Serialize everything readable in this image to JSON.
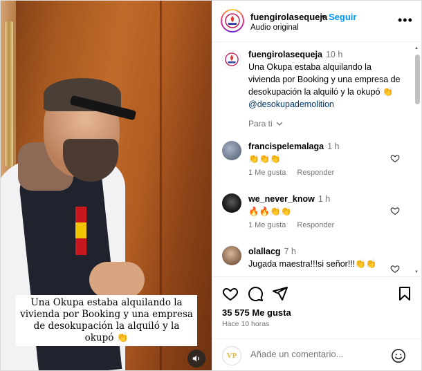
{
  "post": {
    "media": {
      "caption_overlay": "Una Okupa estaba alquilando la vivienda por Booking y una empresa de desokupación la alquiló y la okupó 👏"
    },
    "header": {
      "username": "fuengirolasequeja",
      "dot": "•",
      "follow_label": "Seguir",
      "subtitle": "Audio original",
      "more_label": "•••"
    },
    "caption": {
      "username": "fuengirolasequeja",
      "time": "10 h",
      "text": "Una Okupa estaba alquilando la vivienda por Booking y una empresa de desokupación la alquiló y la okupó 👏",
      "mention": "@desokupademolition",
      "translate_label": "Para ti"
    },
    "comments": [
      {
        "username": "francispelemalaga",
        "time": "1 h",
        "text": "👏👏👏",
        "likes_label": "1 Me gusta",
        "reply_label": "Responder"
      },
      {
        "username": "we_never_know",
        "time": "1 h",
        "text": "🔥🔥👏👏",
        "likes_label": "1 Me gusta",
        "reply_label": "Responder"
      },
      {
        "username": "olallacg",
        "time": "7 h",
        "text": "Jugada maestra!!!si señor!!!👏👏"
      }
    ],
    "likes": "35 575 Me gusta",
    "posted_ago": "Hace 10 horas",
    "add_comment": {
      "placeholder": "Añade un comentario...",
      "avatar_text": "VP"
    }
  },
  "colors": {
    "follow_blue": "#0095f6",
    "mention_blue": "#00376b",
    "muted_gray": "#737373"
  }
}
